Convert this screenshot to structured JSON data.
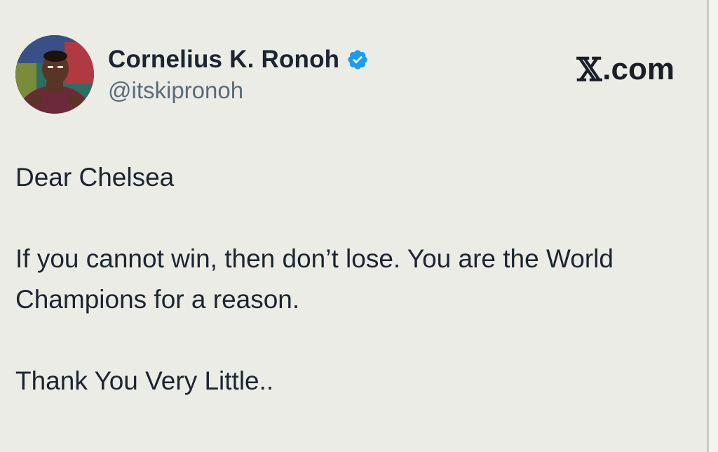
{
  "author": {
    "display_name": "Cornelius K. Ronoh",
    "handle": "@itskipronoh",
    "verified": true,
    "verified_icon": "verified-badge-icon",
    "verified_color": "#1d9bf0",
    "avatar_icon": "profile-photo-avatar"
  },
  "brand": {
    "x_mark": "𝕏",
    "domain": ".com"
  },
  "tweet": {
    "paragraphs": [
      "Dear Chelsea",
      "If you cannot win, then don’t lose. You are the World Champions for a reason.",
      "Thank You Very Little.."
    ]
  },
  "colors": {
    "background": "#ecece6",
    "text": "#1c2530",
    "handle": "#5b6b7a"
  }
}
